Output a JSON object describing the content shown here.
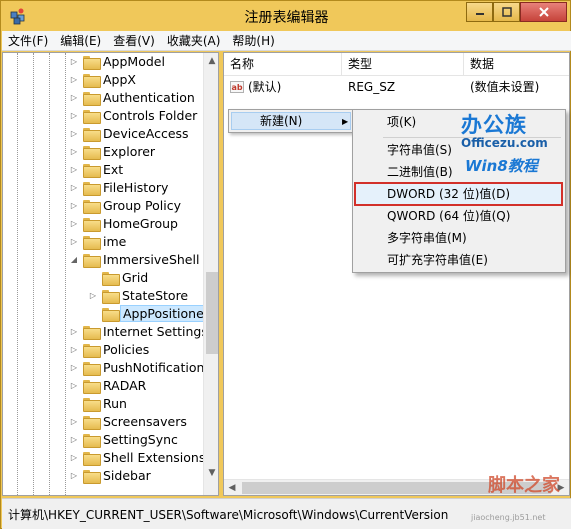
{
  "window": {
    "title": "注册表编辑器"
  },
  "menubar": {
    "items": [
      "文件(F)",
      "编辑(E)",
      "查看(V)",
      "收藏夹(A)",
      "帮助(H)"
    ]
  },
  "tree": {
    "items": [
      {
        "label": "AppModel",
        "expandable": true
      },
      {
        "label": "AppX",
        "expandable": true
      },
      {
        "label": "Authentication",
        "expandable": true
      },
      {
        "label": "Controls Folder",
        "expandable": true
      },
      {
        "label": "DeviceAccess",
        "expandable": true
      },
      {
        "label": "Explorer",
        "expandable": true
      },
      {
        "label": "Ext",
        "expandable": true
      },
      {
        "label": "FileHistory",
        "expandable": true
      },
      {
        "label": "Group Policy",
        "expandable": true
      },
      {
        "label": "HomeGroup",
        "expandable": true
      },
      {
        "label": "ime",
        "expandable": true
      },
      {
        "label": "ImmersiveShell",
        "expandable": true,
        "expanded": true
      },
      {
        "label": "Grid",
        "expandable": false,
        "indent": 1
      },
      {
        "label": "StateStore",
        "expandable": true,
        "indent": 1
      },
      {
        "label": "AppPositioner",
        "expandable": false,
        "indent": 1,
        "selected": true
      },
      {
        "label": "Internet Settings",
        "expandable": true
      },
      {
        "label": "Policies",
        "expandable": true
      },
      {
        "label": "PushNotifications",
        "expandable": true
      },
      {
        "label": "RADAR",
        "expandable": true
      },
      {
        "label": "Run",
        "expandable": false
      },
      {
        "label": "Screensavers",
        "expandable": true
      },
      {
        "label": "SettingSync",
        "expandable": true
      },
      {
        "label": "Shell Extensions",
        "expandable": true
      },
      {
        "label": "Sidebar",
        "expandable": true
      }
    ]
  },
  "list": {
    "columns": [
      "名称",
      "类型",
      "数据"
    ],
    "rows": [
      {
        "icon": "ab",
        "name": "(默认)",
        "type": "REG_SZ",
        "data": "(数值未设置)"
      }
    ]
  },
  "context_menu": {
    "new_label": "新建(N)",
    "submenu": {
      "key": "项(K)",
      "string": "字符串值(S)",
      "binary": "二进制值(B)",
      "dword": "DWORD (32 位)值(D)",
      "qword": "QWORD (64 位)值(Q)",
      "multi": "多字符串值(M)",
      "expand": "可扩充字符串值(E)"
    }
  },
  "watermark": {
    "brand": "办公族",
    "site": "Officezu.com",
    "tag": "Win8教程",
    "bottom": "脚本之家",
    "bottom_site": "jiaocheng.jb51.net"
  },
  "statusbar": {
    "path": "计算机\\HKEY_CURRENT_USER\\Software\\Microsoft\\Windows\\CurrentVersion\\ImmersiveShell"
  },
  "colors": {
    "frame": "#f0c85a",
    "highlight_border": "#d2302a",
    "selection": "#cce8ff"
  }
}
